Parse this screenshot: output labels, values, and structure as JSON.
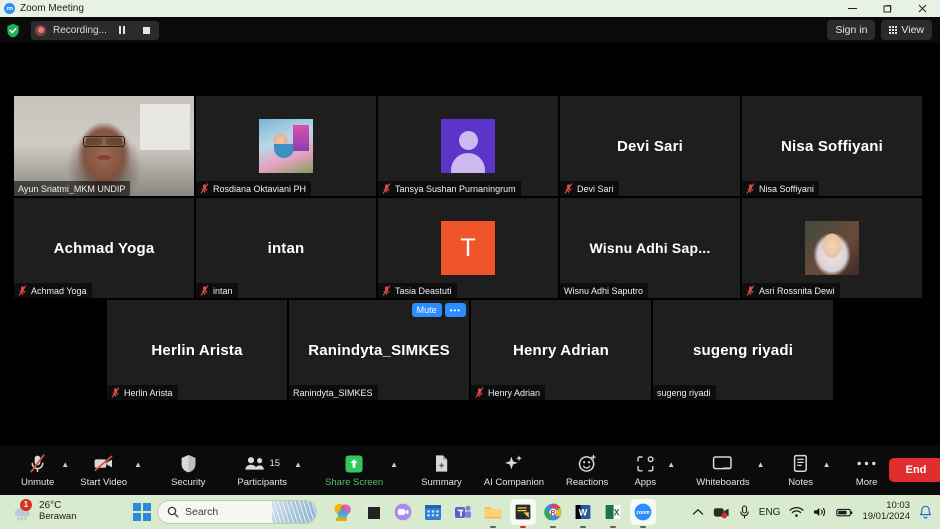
{
  "window": {
    "title": "Zoom Meeting",
    "app_icon": "zoom-logo-icon",
    "minimize": "minimize-icon",
    "maximize": "restore-icon",
    "close": "close-icon"
  },
  "topbar": {
    "encryption_icon": "shield-check-icon",
    "recording_label": "Recording...",
    "record_dot_icon": "record-dot-icon",
    "pause_icon": "pause-icon",
    "stop_icon": "stop-icon",
    "sign_in_label": "Sign in",
    "view_label": "View",
    "view_icon": "grid-view-icon"
  },
  "grid": {
    "rows": [
      {
        "tiles": [
          {
            "name": "Ayun Sriatmi_MKM UNDIP",
            "display": "",
            "kind": "video",
            "art": "cam-ayun",
            "muted": false,
            "active": true
          },
          {
            "name": "Rosdiana Oktaviani PH",
            "display": "",
            "kind": "photo",
            "art": "photo-rosdiana",
            "muted": true,
            "active": false
          },
          {
            "name": "Tansya Sushan Purnaningrum",
            "display": "",
            "kind": "avatar-default",
            "art": "",
            "muted": true,
            "active": false
          },
          {
            "name": "Devi Sari",
            "display": "Devi Sari",
            "kind": "name",
            "art": "",
            "muted": true,
            "active": false
          },
          {
            "name": "Nisa Soffiyani",
            "display": "Nisa Soffiyani",
            "kind": "name",
            "art": "",
            "muted": true,
            "active": false
          }
        ]
      },
      {
        "tiles": [
          {
            "name": "Achmad Yoga",
            "display": "Achmad Yoga",
            "kind": "name",
            "art": "",
            "muted": true,
            "active": false
          },
          {
            "name": "intan",
            "display": "intan",
            "kind": "name",
            "art": "",
            "muted": true,
            "active": false
          },
          {
            "name": "Tasia Deastuti",
            "display": "T",
            "kind": "avatar-initial",
            "art": "",
            "muted": true,
            "active": false
          },
          {
            "name": "Wisnu Adhi Saputro",
            "display": "Wisnu Adhi Sap...",
            "kind": "name",
            "art": "",
            "muted": false,
            "active": false
          },
          {
            "name": "Asri Rossnita Dewi",
            "display": "",
            "kind": "photo",
            "art": "photo-asri",
            "muted": true,
            "active": false
          }
        ]
      },
      {
        "tiles": [
          {
            "name": "Herlin Arista",
            "display": "Herlin Arista",
            "kind": "name",
            "art": "",
            "muted": true,
            "active": false
          },
          {
            "name": "Ranindyta_SIMKES",
            "display": "Ranindyta_SIMKES",
            "kind": "name",
            "art": "",
            "muted": false,
            "active": false,
            "hovered": true,
            "mute_label": "Mute",
            "more_label": "•••"
          },
          {
            "name": "Henry Adrian",
            "display": "Henry Adrian",
            "kind": "name",
            "art": "",
            "muted": true,
            "active": false
          },
          {
            "name": "sugeng riyadi",
            "display": "sugeng riyadi",
            "kind": "name",
            "art": "",
            "muted": false,
            "active": false
          }
        ]
      }
    ]
  },
  "toolbar": {
    "items": [
      {
        "label": "Unmute",
        "icon": "microphone-muted-icon",
        "caret": true,
        "green": false,
        "count": ""
      },
      {
        "label": "Start Video",
        "icon": "camera-off-icon",
        "caret": true,
        "green": false,
        "count": ""
      },
      {
        "label": "Security",
        "icon": "shield-icon",
        "caret": false,
        "green": false,
        "count": ""
      },
      {
        "label": "Participants",
        "icon": "people-icon",
        "caret": true,
        "green": false,
        "count": "15"
      },
      {
        "label": "Share Screen",
        "icon": "share-screen-icon",
        "caret": true,
        "green": true,
        "count": ""
      },
      {
        "label": "Summary",
        "icon": "summary-doc-icon",
        "caret": false,
        "green": false,
        "count": ""
      },
      {
        "label": "AI Companion",
        "icon": "sparkles-icon",
        "caret": false,
        "green": false,
        "count": ""
      },
      {
        "label": "Reactions",
        "icon": "smiley-plus-icon",
        "caret": false,
        "green": false,
        "count": ""
      },
      {
        "label": "Apps",
        "icon": "apps-icon",
        "caret": true,
        "green": false,
        "count": ""
      },
      {
        "label": "Whiteboards",
        "icon": "whiteboard-icon",
        "caret": true,
        "green": false,
        "count": ""
      },
      {
        "label": "Notes",
        "icon": "notes-icon",
        "caret": true,
        "green": false,
        "count": ""
      },
      {
        "label": "More",
        "icon": "more-dots-icon",
        "caret": false,
        "green": false,
        "count": ""
      }
    ],
    "end_label": "End",
    "accent_green": "#4ec26a",
    "end_red": "#e02d2d"
  },
  "taskbar": {
    "weather": {
      "temp": "26°C",
      "condition": "Berawan",
      "badge": "1",
      "icon": "cloud-rain-icon"
    },
    "start_icon": "windows-start-icon",
    "search": {
      "placeholder": "Search",
      "icon": "search-icon"
    },
    "apps": [
      {
        "name": "power-bi-icon",
        "running": false,
        "active": false
      },
      {
        "name": "dark-square-app-icon",
        "running": false,
        "active": false
      },
      {
        "name": "zoom-workplace-icon",
        "running": false,
        "active": false
      },
      {
        "name": "calendar-icon",
        "running": false,
        "active": false
      },
      {
        "name": "microsoft-teams-icon",
        "running": false,
        "active": false
      },
      {
        "name": "file-explorer-icon",
        "running": true,
        "active": false
      },
      {
        "name": "sticky-notes-icon",
        "running": true,
        "active": true
      },
      {
        "name": "chrome-icon",
        "running": true,
        "active": false
      },
      {
        "name": "word-icon",
        "running": true,
        "active": false
      },
      {
        "name": "excel-icon",
        "running": true,
        "active": false
      },
      {
        "name": "zoom-meeting-icon",
        "running": true,
        "active": true
      }
    ],
    "tray": {
      "overflow_icon": "chevron-up-icon",
      "capture_icon": "recording-indicator-icon",
      "mic_icon": "microphone-icon",
      "language": "ENG",
      "wifi_icon": "wifi-icon",
      "volume_icon": "volume-icon",
      "battery_icon": "battery-icon",
      "time": "10:03",
      "date": "19/01/2024",
      "notification_icon": "bell-icon"
    }
  }
}
